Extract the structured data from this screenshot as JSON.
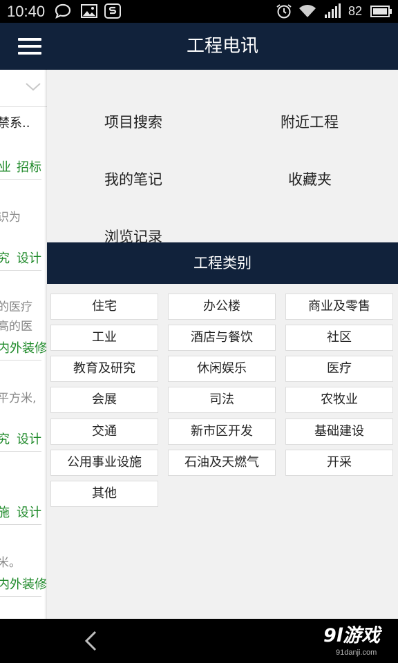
{
  "status_bar": {
    "time": "10:40",
    "battery": "82"
  },
  "drawer": {
    "title": "工程电讯",
    "quick_links": [
      "项目搜索",
      "附近工程",
      "我的笔记",
      "收藏夹",
      "浏览记录"
    ],
    "categories_title": "工程类别",
    "categories": [
      "住宅",
      "办公楼",
      "商业及零售",
      "工业",
      "酒店与餐饮",
      "社区",
      "教育及研究",
      "休闲娱乐",
      "医疗",
      "会展",
      "司法",
      "农牧业",
      "交通",
      "新市区开发",
      "基础建设",
      "公用事业设施",
      "石油及天燃气",
      "开采",
      "其他"
    ]
  },
  "background_list": {
    "fragments": [
      "禁系..",
      "业",
      "招标",
      "识为",
      "究",
      "设计",
      "的医疗",
      "高的医",
      "内外装修",
      "平方米,",
      "究",
      "设计",
      "施",
      "设计",
      "米。",
      "内外装修"
    ]
  },
  "watermark": {
    "logo": "9l游戏",
    "site": "91danji.com"
  },
  "icons": {
    "status": [
      "chat-bubble-icon",
      "image-icon",
      "app-s-icon",
      "alarm-icon",
      "wifi-icon",
      "signal-icon",
      "battery-icon"
    ],
    "menu": "menu-icon",
    "chevron": "chevron-down-icon",
    "back": "back-icon"
  }
}
